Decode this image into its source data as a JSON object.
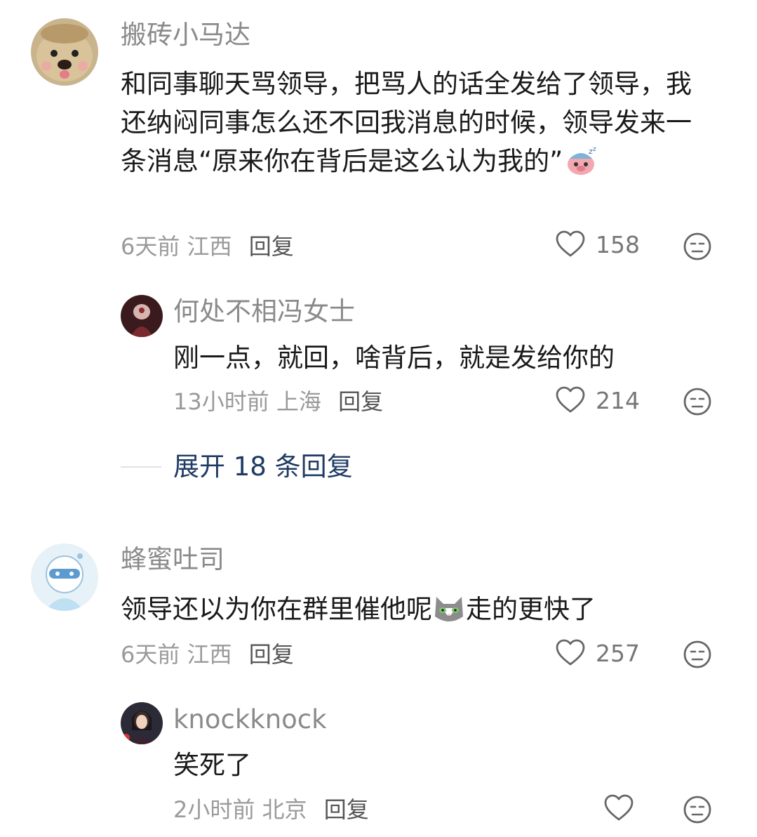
{
  "comments": [
    {
      "username": "搬砖小马达",
      "content": "和同事聊天骂领导，把骂人的话全发给了领导，我还纳闷同事怎么还不回我消息的时候，领导发来一条消息“原来你在背后是这么认为我的”",
      "emoji": "sleepy-pig-emoji",
      "time": "6天前",
      "location": "江西",
      "reply_label": "回复",
      "likes": "158",
      "replies": [
        {
          "username": "何处不相冯女士",
          "content": "刚一点，就回，啥背后，就是发给你的",
          "time": "13小时前",
          "location": "上海",
          "reply_label": "回复",
          "likes": "214"
        }
      ],
      "expand_label": "展开 18 条回复"
    },
    {
      "username": "蜂蜜吐司",
      "content_before": "领导还以为你在群里催他呢",
      "emoji": "cat-emoji",
      "content_after": "走的更快了",
      "time": "6天前",
      "location": "江西",
      "reply_label": "回复",
      "likes": "257",
      "replies": [
        {
          "username": "knockknock",
          "content": "笑死了",
          "time": "2小时前",
          "location": "北京",
          "reply_label": "回复",
          "likes": ""
        }
      ]
    }
  ],
  "colors": {
    "username": "#8a8a8a",
    "content": "#1a1a1a",
    "meta": "#9a9a9a",
    "expand": "#1f3b63"
  },
  "icons": [
    "heart-outline-icon",
    "dislike-face-icon"
  ]
}
